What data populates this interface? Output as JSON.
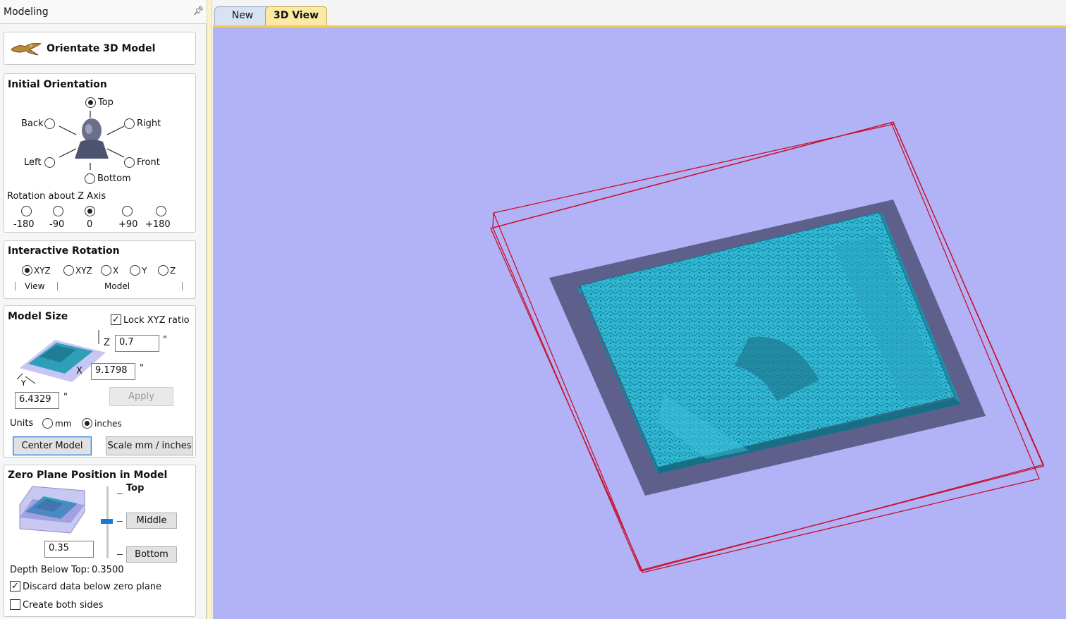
{
  "panel": {
    "title": "Modeling",
    "pin_icon": "pin-icon"
  },
  "header_card": {
    "title": "Orientate 3D Model",
    "icon": "eagle-icon"
  },
  "initial_orientation": {
    "title": "Initial Orientation",
    "options": {
      "top": "Top",
      "back": "Back",
      "right": "Right",
      "left": "Left",
      "front": "Front",
      "bottom": "Bottom"
    },
    "selected": "Top",
    "rotation_label": "Rotation about Z Axis",
    "rotation_options": [
      "-180",
      "-90",
      "0",
      "+90",
      "+180"
    ],
    "rotation_selected": "0"
  },
  "interactive_rotation": {
    "title": "Interactive Rotation",
    "options": [
      "XYZ",
      "XYZ",
      "X",
      "Y",
      "Z"
    ],
    "selected": "XYZ",
    "view_label": "View",
    "model_label": "Model"
  },
  "model_size": {
    "title": "Model Size",
    "lock_label": "Lock XYZ ratio",
    "lock_checked": true,
    "z_label": "Z",
    "z_value": "0.7",
    "x_label": "X",
    "x_value": "9.1798",
    "y_label": "Y",
    "y_value": "6.4329",
    "unit_mark": "\"",
    "apply_label": "Apply",
    "units_label": "Units",
    "unit_mm": "mm",
    "unit_inches": "inches",
    "units_selected": "inches",
    "center_button": "Center Model",
    "scale_button": "Scale mm / inches"
  },
  "zero_plane": {
    "title": "Zero Plane Position in Model",
    "top_label": "Top",
    "middle_button": "Middle",
    "bottom_button": "Bottom",
    "value": "0.35",
    "depth_label": "Depth Below Top:",
    "depth_value": "0.3500",
    "discard_label": "Discard data below zero plane",
    "discard_checked": true,
    "both_sides_label": "Create both sides",
    "both_sides_checked": false
  },
  "tabs": {
    "new": "New",
    "view3d": "3D View"
  },
  "colors": {
    "viewport_bg": "#b1b3f6",
    "model": "#2fb6d2",
    "base_plate": "#5f5f8c",
    "bounding_box": "#c8102e",
    "tab_active": "#fbe9a5"
  }
}
